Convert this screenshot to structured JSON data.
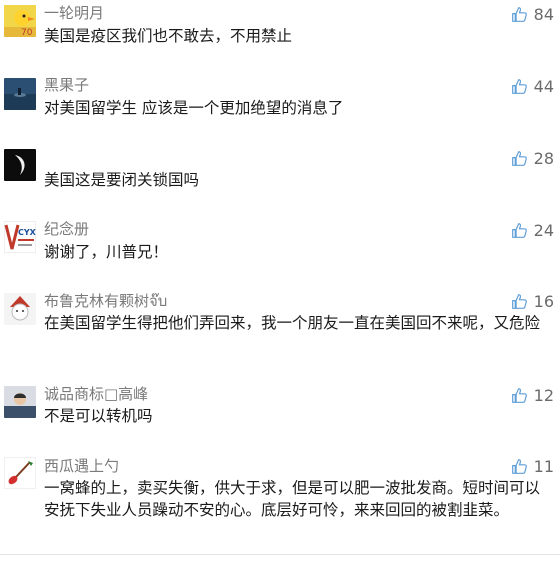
{
  "colors": {
    "username": "#7a7a7a",
    "text": "#1a1a1a",
    "like": "#6b6b6b",
    "like_icon": "#5e9ed6"
  },
  "comments": [
    {
      "username": "一轮明月",
      "text": "美国是疫区我们也不敢去，不用禁止",
      "likes": "84",
      "avatar_icon": "rubber-duck-avatar-icon",
      "avatar_badge": "70"
    },
    {
      "username": "黑果子",
      "text": "对美国留学生 应该是一个更加绝望的消息了",
      "likes": "44",
      "avatar_icon": "landscape-avatar-icon"
    },
    {
      "username": "",
      "text": "美国这是要闭关锁国吗",
      "likes": "28",
      "avatar_icon": "dark-swirl-avatar-icon"
    },
    {
      "username": "纪念册",
      "text": "谢谢了，川普兄！",
      "likes": "24",
      "avatar_icon": "cyx-logo-avatar-icon",
      "avatar_badge": "CYX"
    },
    {
      "username": "布鲁克林有颗树จ๊บ",
      "text": "在美国留学生得把他们弄回来，我一个朋友一直在美国回不来呢，又危险",
      "likes": "16",
      "avatar_icon": "cartoon-avatar-icon"
    },
    {
      "username": "诚品商标□高峰",
      "text": "不是可以转机吗",
      "likes": "12",
      "avatar_icon": "person-avatar-icon"
    },
    {
      "username": "西瓜遇上勺",
      "text": "一窝蜂的上，卖买失衡，供大于求，但是可以肥一波批发商。短时间可以安抚下失业人员躁动不安的心。底层好可怜，来来回回的被割韭菜。",
      "likes": "11",
      "avatar_icon": "red-spoon-avatar-icon"
    }
  ]
}
